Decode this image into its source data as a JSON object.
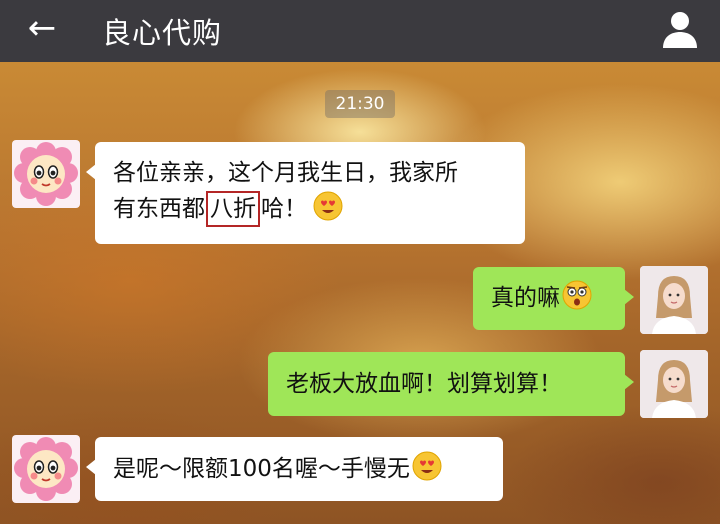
{
  "header": {
    "back_icon": "←",
    "title": "良心代购",
    "profile_icon": "person-icon"
  },
  "chat": {
    "timestamp": "21:30",
    "messages": [
      {
        "side": "left",
        "avatar": "flower-avatar",
        "line1": "各位亲亲，这个月我生日，我家所",
        "line2_before": "有东西都",
        "line2_highlight": "八折",
        "line2_after": "哈！",
        "emoji": "heart-eyes-emoji"
      },
      {
        "side": "right",
        "avatar": "girl-avatar",
        "text": "真的嘛",
        "emoji": "shocked-emoji"
      },
      {
        "side": "right",
        "avatar": "girl-avatar",
        "text": "老板大放血啊！划算划算！"
      },
      {
        "side": "left",
        "avatar": "flower-avatar",
        "text": "是呢～限额100名喔～手慢无",
        "emoji": "heart-eyes-emoji"
      }
    ]
  },
  "colors": {
    "header_bg": "#3b3a3f",
    "bubble_left": "#ffffff",
    "bubble_right": "#9fe658",
    "highlight_border": "#b42626"
  }
}
